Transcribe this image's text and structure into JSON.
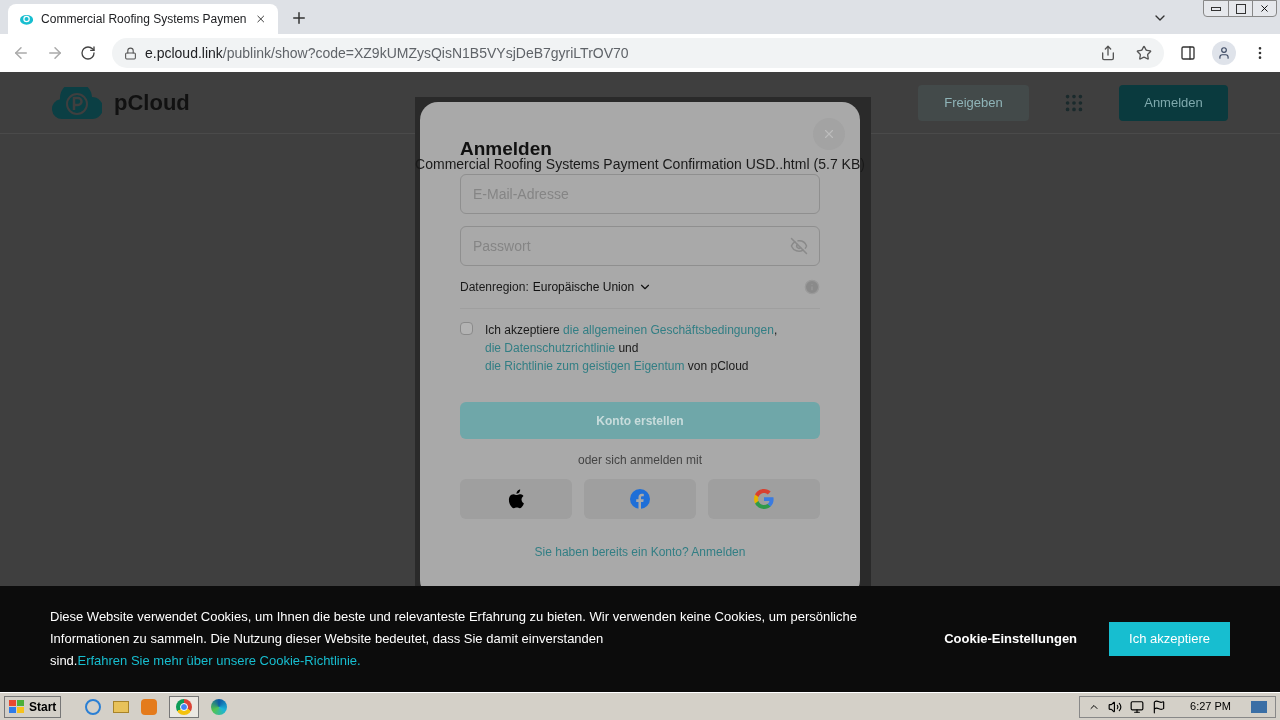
{
  "browser": {
    "tab_title": "Commercial Roofing Systems Paymen",
    "address_host": "e.pcloud.link",
    "address_path": "/publink/show?code=XZ9kUMZysQisN1B5VYsjDeB7gyriLTrOV70"
  },
  "header": {
    "logo_text": "pCloud",
    "share_button": "Freigeben",
    "login_button": "Anmelden"
  },
  "file_title": "Commercial Roofing Systems Payment Confirmation USD..html",
  "file_size": "(5.7 KB)",
  "modal": {
    "title": "Anmelden",
    "email_placeholder": "E-Mail-Adresse",
    "password_placeholder": "Passwort",
    "region_label": "Datenregion:",
    "region_value": "Europäische Union",
    "terms": {
      "checked": false,
      "parts": [
        {
          "kind": "text",
          "text": "Ich akzeptiere "
        },
        {
          "kind": "link",
          "text": "die allgemeinen Geschäftsbedingungen"
        },
        {
          "kind": "text",
          "text": ", "
        },
        {
          "kind": "link",
          "text": "die Datenschutzrichtlinie"
        },
        {
          "kind": "text",
          "text": " und "
        },
        {
          "kind": "link",
          "text": "die Richtlinie zum geistigen Eigentum"
        },
        {
          "kind": "text",
          "text": " von pCloud"
        }
      ]
    },
    "create_button": "Konto erstellen",
    "divider_text": "oder sich anmelden mit",
    "social": [
      {
        "kind": "apple"
      },
      {
        "kind": "facebook"
      },
      {
        "kind": "google"
      }
    ],
    "login_link": "Sie haben bereits ein Konto? Anmelden"
  },
  "cookie": {
    "text": "Diese Website verwendet Cookies, um Ihnen die beste und relevanteste Erfahrung zu bieten. Wir verwenden keine Cookies, um persönliche Informationen zu sammeln. Die Nutzung dieser Website bedeutet, dass Sie damit einverstanden sind.",
    "link": "Erfahren Sie mehr über unsere Cookie-Richtlinie.",
    "settings_button": "Cookie-Einstellungen",
    "accept_button": "Ich akzeptiere"
  },
  "taskbar": {
    "start": "Start",
    "clock": "6:27 PM"
  }
}
